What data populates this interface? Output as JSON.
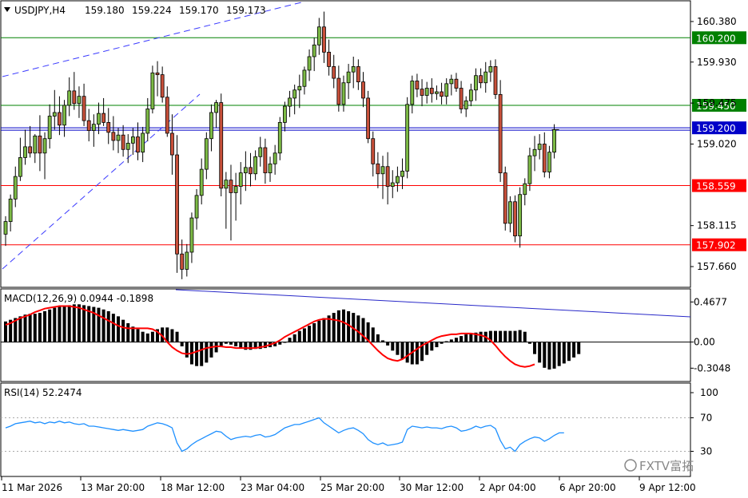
{
  "chart_data": {
    "type": "candlestick",
    "symbol": "USDJPY,H4",
    "ohlc_header": {
      "open": "159.180",
      "high": "159.224",
      "low": "159.170",
      "close": "159.173"
    },
    "price_axis": {
      "ticks": [
        "160.380",
        "159.930",
        "159.475",
        "159.020",
        "158.115",
        "157.660"
      ],
      "range": [
        157.43,
        160.61
      ]
    },
    "horizontal_lines": [
      {
        "price": 160.2,
        "label": "160.200",
        "color": "#008000"
      },
      {
        "price": 159.45,
        "label": "159.450",
        "color": "#008000"
      },
      {
        "price": 159.2,
        "label": "159.200",
        "color": "#0000c8"
      },
      {
        "price": 158.559,
        "label": "158.559",
        "color": "#ff0000"
      },
      {
        "price": 157.902,
        "label": "157.902",
        "color": "#ff0000"
      }
    ],
    "candles": [
      [
        158.02,
        158.22,
        157.89,
        158.16
      ],
      [
        158.16,
        158.46,
        158.05,
        158.41
      ],
      [
        158.41,
        158.77,
        158.32,
        158.66
      ],
      [
        158.66,
        159.09,
        158.61,
        158.87
      ],
      [
        158.87,
        159.18,
        158.79,
        158.99
      ],
      [
        158.99,
        159.22,
        158.87,
        158.92
      ],
      [
        158.92,
        159.13,
        158.81,
        159.11
      ],
      [
        159.11,
        159.34,
        158.72,
        158.92
      ],
      [
        158.92,
        159.15,
        158.63,
        159.08
      ],
      [
        159.08,
        159.46,
        158.97,
        159.33
      ],
      [
        159.33,
        159.62,
        159.18,
        159.37
      ],
      [
        159.37,
        159.55,
        159.12,
        159.23
      ],
      [
        159.23,
        159.51,
        159.1,
        159.45
      ],
      [
        159.45,
        159.76,
        159.33,
        159.61
      ],
      [
        159.61,
        159.82,
        159.4,
        159.47
      ],
      [
        159.47,
        159.66,
        159.31,
        159.55
      ],
      [
        159.55,
        159.69,
        159.22,
        159.28
      ],
      [
        159.28,
        159.41,
        159.05,
        159.17
      ],
      [
        159.17,
        159.35,
        158.99,
        159.24
      ],
      [
        159.24,
        159.48,
        159.13,
        159.36
      ],
      [
        159.36,
        159.53,
        159.22,
        159.26
      ],
      [
        159.26,
        159.42,
        159.02,
        159.15
      ],
      [
        159.15,
        159.33,
        158.95,
        159.06
      ],
      [
        159.06,
        159.2,
        158.92,
        159.12
      ],
      [
        159.12,
        159.23,
        158.88,
        158.96
      ],
      [
        158.96,
        159.13,
        158.81,
        159.03
      ],
      [
        159.03,
        159.2,
        158.9,
        159.1
      ],
      [
        159.1,
        159.26,
        158.84,
        158.93
      ],
      [
        158.93,
        159.21,
        158.82,
        159.14
      ],
      [
        159.14,
        159.53,
        159.05,
        159.41
      ],
      [
        159.41,
        159.89,
        159.36,
        159.81
      ],
      [
        159.81,
        159.94,
        159.55,
        159.79
      ],
      [
        159.79,
        159.88,
        159.48,
        159.54
      ],
      [
        159.54,
        159.66,
        159.1,
        159.14
      ],
      [
        159.14,
        159.35,
        158.68,
        158.9
      ],
      [
        158.9,
        159.12,
        157.59,
        157.8
      ],
      [
        157.8,
        157.96,
        157.52,
        157.63
      ],
      [
        157.63,
        157.91,
        157.55,
        157.82
      ],
      [
        157.82,
        158.26,
        157.7,
        158.2
      ],
      [
        158.2,
        158.52,
        158.07,
        158.45
      ],
      [
        158.45,
        158.86,
        158.35,
        158.74
      ],
      [
        158.74,
        159.15,
        158.63,
        159.08
      ],
      [
        159.08,
        159.46,
        158.94,
        159.37
      ],
      [
        159.37,
        159.51,
        159.2,
        159.48
      ],
      [
        159.48,
        159.58,
        158.44,
        158.53
      ],
      [
        158.53,
        158.71,
        158.08,
        158.62
      ],
      [
        158.62,
        158.79,
        157.95,
        158.48
      ],
      [
        158.48,
        158.7,
        158.17,
        158.55
      ],
      [
        158.55,
        158.82,
        158.35,
        158.7
      ],
      [
        158.7,
        158.94,
        158.5,
        158.76
      ],
      [
        158.76,
        158.92,
        158.55,
        158.69
      ],
      [
        158.69,
        158.95,
        158.62,
        158.88
      ],
      [
        158.88,
        159.1,
        158.77,
        158.98
      ],
      [
        158.98,
        159.08,
        158.58,
        158.7
      ],
      [
        158.7,
        158.88,
        158.6,
        158.8
      ],
      [
        158.8,
        159.01,
        158.68,
        158.92
      ],
      [
        158.92,
        159.32,
        158.84,
        159.26
      ],
      [
        159.26,
        159.49,
        159.16,
        159.44
      ],
      [
        159.44,
        159.61,
        159.32,
        159.53
      ],
      [
        159.53,
        159.68,
        159.35,
        159.62
      ],
      [
        159.62,
        159.79,
        159.42,
        159.66
      ],
      [
        159.66,
        159.88,
        159.57,
        159.84
      ],
      [
        159.84,
        160.07,
        159.72,
        159.99
      ],
      [
        159.99,
        160.2,
        159.83,
        160.12
      ],
      [
        160.12,
        160.42,
        160.01,
        160.32
      ],
      [
        160.32,
        160.49,
        159.92,
        160.04
      ],
      [
        160.04,
        160.18,
        159.78,
        159.88
      ],
      [
        159.88,
        160.01,
        159.64,
        159.75
      ],
      [
        159.75,
        159.89,
        159.38,
        159.46
      ],
      [
        159.46,
        159.78,
        159.38,
        159.7
      ],
      [
        159.7,
        159.91,
        159.52,
        159.82
      ],
      [
        159.82,
        159.99,
        159.64,
        159.88
      ],
      [
        159.88,
        159.96,
        159.62,
        159.71
      ],
      [
        159.71,
        159.82,
        159.43,
        159.53
      ],
      [
        159.53,
        159.61,
        159.03,
        159.08
      ],
      [
        159.08,
        159.16,
        158.66,
        158.8
      ],
      [
        158.8,
        158.93,
        158.53,
        158.69
      ],
      [
        158.69,
        158.89,
        158.41,
        158.77
      ],
      [
        158.77,
        158.93,
        158.35,
        158.55
      ],
      [
        158.55,
        158.73,
        158.42,
        158.59
      ],
      [
        158.59,
        158.77,
        158.49,
        158.66
      ],
      [
        158.66,
        158.86,
        158.52,
        158.72
      ],
      [
        158.72,
        159.54,
        158.64,
        159.46
      ],
      [
        159.46,
        159.78,
        159.36,
        159.72
      ],
      [
        159.72,
        159.8,
        159.54,
        159.63
      ],
      [
        159.63,
        159.74,
        159.44,
        159.56
      ],
      [
        159.56,
        159.71,
        159.47,
        159.64
      ],
      [
        159.64,
        159.75,
        159.48,
        159.58
      ],
      [
        159.58,
        159.67,
        159.51,
        159.6
      ],
      [
        159.6,
        159.7,
        159.46,
        159.55
      ],
      [
        159.55,
        159.75,
        159.46,
        159.69
      ],
      [
        159.69,
        159.79,
        159.56,
        159.74
      ],
      [
        159.74,
        159.81,
        159.6,
        159.64
      ],
      [
        159.64,
        159.72,
        159.36,
        159.41
      ],
      [
        159.41,
        159.55,
        159.32,
        159.5
      ],
      [
        159.5,
        159.69,
        159.44,
        159.62
      ],
      [
        159.62,
        159.86,
        159.5,
        159.78
      ],
      [
        159.78,
        159.86,
        159.64,
        159.7
      ],
      [
        159.7,
        159.93,
        159.59,
        159.82
      ],
      [
        159.82,
        159.95,
        159.71,
        159.88
      ],
      [
        159.88,
        159.96,
        159.52,
        159.57
      ],
      [
        159.57,
        159.73,
        158.6,
        158.7
      ],
      [
        158.7,
        158.77,
        158.06,
        158.14
      ],
      [
        158.14,
        158.44,
        158.04,
        158.38
      ],
      [
        158.38,
        158.45,
        157.93,
        158.0
      ],
      [
        158.0,
        158.54,
        157.87,
        158.46
      ],
      [
        158.46,
        158.64,
        158.34,
        158.58
      ],
      [
        158.58,
        158.98,
        158.5,
        158.89
      ],
      [
        158.89,
        159.11,
        158.72,
        158.96
      ],
      [
        158.96,
        159.13,
        158.85,
        159.02
      ],
      [
        159.02,
        159.15,
        158.65,
        158.71
      ],
      [
        158.71,
        159.0,
        158.64,
        158.93
      ],
      [
        158.93,
        159.24,
        158.86,
        159.18
      ]
    ],
    "time_axis": {
      "labels": [
        "11 Mar 2026",
        "13 Mar 20:00",
        "18 Mar 12:00",
        "23 Mar 04:00",
        "25 Mar 20:00",
        "30 Mar 12:00",
        "2 Apr 04:00",
        "6 Apr 20:00",
        "9 Apr 12:00"
      ]
    },
    "macd": {
      "header": "MACD(12,26,9) 0.0944 -0.1898",
      "ticks": [
        "0.4677",
        "0.00",
        "-0.3048"
      ],
      "range": [
        -0.46,
        0.62
      ],
      "histogram": [
        0.24,
        0.26,
        0.28,
        0.3,
        0.32,
        0.33,
        0.33,
        0.34,
        0.36,
        0.38,
        0.4,
        0.41,
        0.42,
        0.43,
        0.44,
        0.44,
        0.43,
        0.42,
        0.41,
        0.4,
        0.38,
        0.36,
        0.33,
        0.3,
        0.26,
        0.22,
        0.18,
        0.15,
        0.12,
        0.1,
        0.12,
        0.15,
        0.17,
        0.17,
        0.15,
        0.12,
        -0.05,
        -0.18,
        -0.26,
        -0.28,
        -0.28,
        -0.24,
        -0.18,
        -0.12,
        -0.06,
        -0.02,
        -0.03,
        -0.05,
        -0.07,
        -0.09,
        -0.09,
        -0.08,
        -0.08,
        -0.07,
        -0.06,
        -0.05,
        -0.03,
        0.0,
        0.05,
        0.09,
        0.13,
        0.16,
        0.19,
        0.22,
        0.25,
        0.28,
        0.31,
        0.34,
        0.37,
        0.38,
        0.36,
        0.34,
        0.31,
        0.28,
        0.23,
        0.17,
        0.09,
        0.02,
        -0.04,
        -0.1,
        -0.15,
        -0.2,
        -0.24,
        -0.26,
        -0.26,
        -0.22,
        -0.15,
        -0.1,
        -0.06,
        -0.02,
        0.01,
        0.03,
        0.05,
        0.07,
        0.09,
        0.1,
        0.11,
        0.12,
        0.12,
        0.13,
        0.13,
        0.13,
        0.13,
        0.13,
        0.13,
        0.14,
        0.12,
        -0.02,
        -0.14,
        -0.24,
        -0.3,
        -0.32,
        -0.31,
        -0.28,
        -0.25,
        -0.22,
        -0.18,
        -0.14
      ],
      "signal": [
        0.2,
        0.22,
        0.25,
        0.28,
        0.3,
        0.32,
        0.35,
        0.37,
        0.39,
        0.4,
        0.41,
        0.42,
        0.42,
        0.42,
        0.41,
        0.4,
        0.38,
        0.36,
        0.34,
        0.31,
        0.28,
        0.25,
        0.22,
        0.19,
        0.17,
        0.16,
        0.16,
        0.16,
        0.16,
        0.16,
        0.15,
        0.12,
        0.07,
        0.0,
        -0.06,
        -0.1,
        -0.13,
        -0.14,
        -0.13,
        -0.11,
        -0.09,
        -0.07,
        -0.06,
        -0.05,
        -0.05,
        -0.06,
        -0.06,
        -0.07,
        -0.07,
        -0.07,
        -0.07,
        -0.07,
        -0.06,
        -0.05,
        -0.03,
        -0.01,
        0.02,
        0.06,
        0.09,
        0.12,
        0.15,
        0.18,
        0.21,
        0.24,
        0.26,
        0.27,
        0.27,
        0.26,
        0.25,
        0.23,
        0.2,
        0.16,
        0.12,
        0.07,
        0.02,
        -0.04,
        -0.1,
        -0.15,
        -0.19,
        -0.21,
        -0.22,
        -0.2,
        -0.16,
        -0.12,
        -0.08,
        -0.04,
        -0.01,
        0.02,
        0.05,
        0.07,
        0.08,
        0.09,
        0.09,
        0.1,
        0.1,
        0.1,
        0.09,
        0.08,
        0.06,
        0.02,
        -0.04,
        -0.11,
        -0.17,
        -0.22,
        -0.26,
        -0.28,
        -0.29,
        -0.28,
        -0.26
      ]
    },
    "rsi": {
      "header": "RSI(14) 52.2474",
      "ticks": [
        "100",
        "70",
        "30"
      ],
      "range": [
        0,
        100
      ],
      "values": [
        58,
        60,
        63,
        64,
        65,
        66,
        64,
        65,
        63,
        65,
        64,
        66,
        64,
        65,
        63,
        62,
        63,
        60,
        60,
        59,
        58,
        57,
        56,
        55,
        56,
        55,
        54,
        55,
        56,
        60,
        62,
        64,
        63,
        61,
        58,
        40,
        30,
        33,
        38,
        42,
        45,
        48,
        51,
        54,
        53,
        48,
        44,
        46,
        47,
        48,
        47,
        49,
        50,
        47,
        48,
        50,
        54,
        58,
        60,
        62,
        62,
        64,
        66,
        68,
        70,
        64,
        60,
        56,
        52,
        55,
        57,
        58,
        55,
        51,
        44,
        40,
        38,
        40,
        37,
        38,
        39,
        41,
        56,
        60,
        59,
        58,
        59,
        58,
        58,
        57,
        59,
        60,
        58,
        54,
        55,
        57,
        60,
        58,
        60,
        61,
        57,
        43,
        33,
        35,
        30,
        38,
        42,
        45,
        47,
        46,
        42,
        45,
        49,
        52,
        52
      ]
    }
  },
  "watermark": {
    "text": "FXTV富拓"
  }
}
